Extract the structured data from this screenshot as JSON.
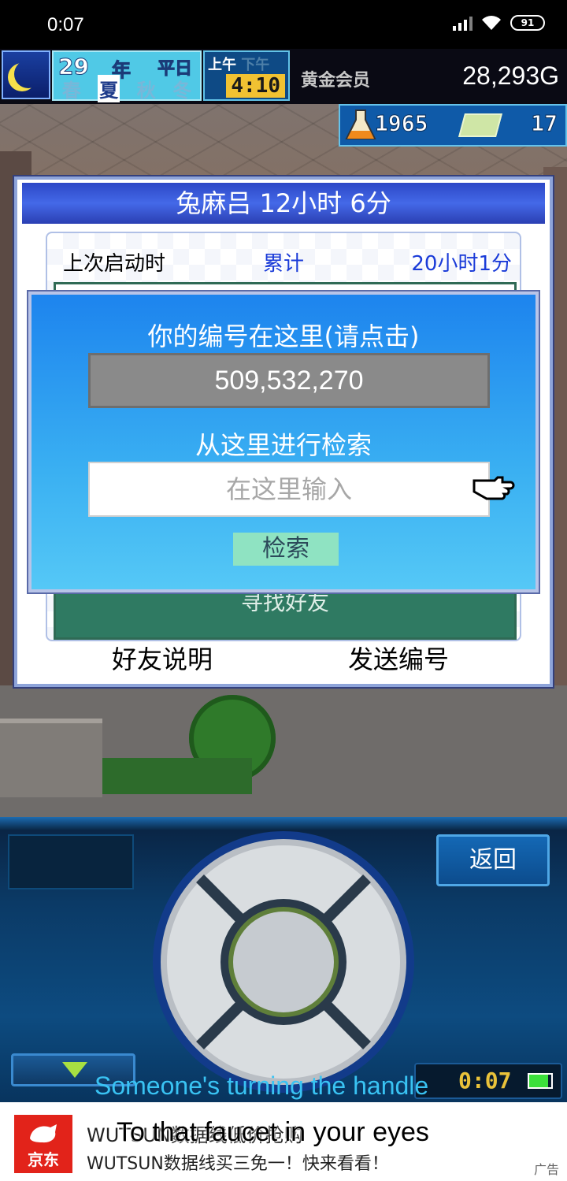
{
  "status_bar": {
    "time": "0:07",
    "battery": "91"
  },
  "hud": {
    "year": "29",
    "year_label": "年",
    "weekday": "平日",
    "seasons": [
      "春",
      "夏",
      "秋",
      "冬"
    ],
    "current_season": "夏",
    "am": "上午",
    "pm": "下午",
    "clock": "4:10",
    "member_label": "黄金会员",
    "money": "28,293G",
    "research_points": "1965",
    "tickets": "17"
  },
  "dialog": {
    "title": "兔麻吕  12小时 6分",
    "last_launch_label": "上次启动时",
    "cumulative_label": "累计",
    "cumulative_value": "20小时1分",
    "find_friend_label": "寻找好友",
    "friend_help_label": "好友说明",
    "send_id_label": "发送编号"
  },
  "search_panel": {
    "id_title": "你的编号在这里(请点击)",
    "id_value": "509,532,270",
    "search_title": "从这里进行检索",
    "input_placeholder": "在这里输入",
    "search_button": "检索"
  },
  "controller": {
    "back_label": "返回",
    "timer": "0:07"
  },
  "ad": {
    "brand": "京东",
    "line1": "WUTSUN数据线低价抢购",
    "line2": "WUTSUN数据线买三免一！快来看看！",
    "tag": "广告"
  },
  "lyrics": {
    "line1": "Someone's turning the handle",
    "line2": "To that faucet in your eyes"
  },
  "colors": {
    "dialog_title_bg": "#3556d6",
    "panel_bg": "#2a9cf0",
    "link_blue": "#1a3bd8",
    "find_button_green": "#2f7a62",
    "search_button_bg": "#8fe3c2",
    "lyric_cyan": "#39c3f3"
  }
}
